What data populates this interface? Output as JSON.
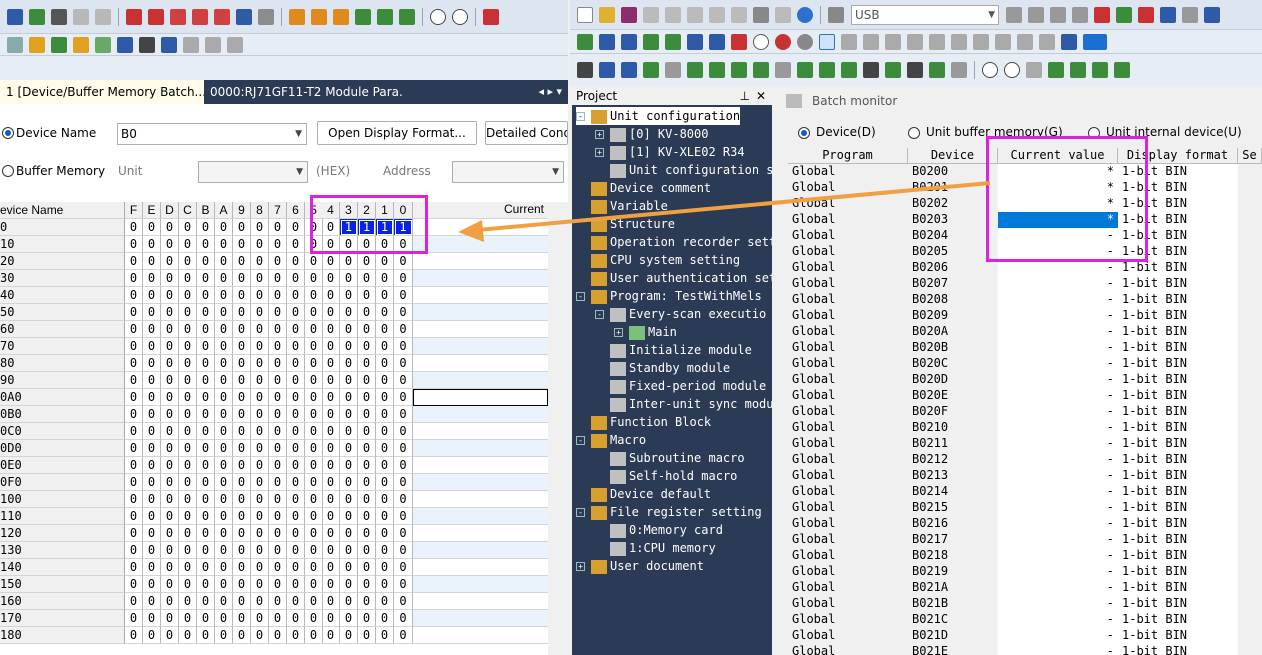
{
  "left": {
    "tabs": [
      {
        "label": "1 [Device/Buffer Memory Batch...",
        "active": true
      },
      {
        "label": "0000:RJ71GF11-T2 Module Para...",
        "active": false
      }
    ],
    "device_name_label": "Device Name",
    "device_name_value": "B0",
    "open_display_format": "Open Display Format...",
    "detailed_conditions": "Detailed Condi",
    "buffer_memory_label": "Buffer Memory",
    "unit_label": "Unit",
    "hex_label": "(HEX)",
    "address_label": "Address",
    "grid_header": {
      "name": "evice Name",
      "bits": [
        "F",
        "E",
        "D",
        "C",
        "B",
        "A",
        "9",
        "8",
        "7",
        "6",
        "5",
        "4",
        "3",
        "2",
        "1",
        "0"
      ],
      "current": "Current"
    },
    "grid_rows": [
      {
        "name": "0",
        "bits": [
          "0",
          "0",
          "0",
          "0",
          "0",
          "0",
          "0",
          "0",
          "0",
          "0",
          "0",
          "0",
          "1",
          "1",
          "1",
          "1"
        ]
      },
      {
        "name": "10",
        "bits": [
          "0",
          "0",
          "0",
          "0",
          "0",
          "0",
          "0",
          "0",
          "0",
          "0",
          "0",
          "0",
          "0",
          "0",
          "0",
          "0"
        ]
      },
      {
        "name": "20",
        "bits": [
          "0",
          "0",
          "0",
          "0",
          "0",
          "0",
          "0",
          "0",
          "0",
          "0",
          "0",
          "0",
          "0",
          "0",
          "0",
          "0"
        ]
      },
      {
        "name": "30",
        "bits": [
          "0",
          "0",
          "0",
          "0",
          "0",
          "0",
          "0",
          "0",
          "0",
          "0",
          "0",
          "0",
          "0",
          "0",
          "0",
          "0"
        ]
      },
      {
        "name": "40",
        "bits": [
          "0",
          "0",
          "0",
          "0",
          "0",
          "0",
          "0",
          "0",
          "0",
          "0",
          "0",
          "0",
          "0",
          "0",
          "0",
          "0"
        ]
      },
      {
        "name": "50",
        "bits": [
          "0",
          "0",
          "0",
          "0",
          "0",
          "0",
          "0",
          "0",
          "0",
          "0",
          "0",
          "0",
          "0",
          "0",
          "0",
          "0"
        ]
      },
      {
        "name": "60",
        "bits": [
          "0",
          "0",
          "0",
          "0",
          "0",
          "0",
          "0",
          "0",
          "0",
          "0",
          "0",
          "0",
          "0",
          "0",
          "0",
          "0"
        ]
      },
      {
        "name": "70",
        "bits": [
          "0",
          "0",
          "0",
          "0",
          "0",
          "0",
          "0",
          "0",
          "0",
          "0",
          "0",
          "0",
          "0",
          "0",
          "0",
          "0"
        ]
      },
      {
        "name": "80",
        "bits": [
          "0",
          "0",
          "0",
          "0",
          "0",
          "0",
          "0",
          "0",
          "0",
          "0",
          "0",
          "0",
          "0",
          "0",
          "0",
          "0"
        ]
      },
      {
        "name": "90",
        "bits": [
          "0",
          "0",
          "0",
          "0",
          "0",
          "0",
          "0",
          "0",
          "0",
          "0",
          "0",
          "0",
          "0",
          "0",
          "0",
          "0"
        ]
      },
      {
        "name": "0A0",
        "bits": [
          "0",
          "0",
          "0",
          "0",
          "0",
          "0",
          "0",
          "0",
          "0",
          "0",
          "0",
          "0",
          "0",
          "0",
          "0",
          "0"
        ]
      },
      {
        "name": "0B0",
        "bits": [
          "0",
          "0",
          "0",
          "0",
          "0",
          "0",
          "0",
          "0",
          "0",
          "0",
          "0",
          "0",
          "0",
          "0",
          "0",
          "0"
        ]
      },
      {
        "name": "0C0",
        "bits": [
          "0",
          "0",
          "0",
          "0",
          "0",
          "0",
          "0",
          "0",
          "0",
          "0",
          "0",
          "0",
          "0",
          "0",
          "0",
          "0"
        ]
      },
      {
        "name": "0D0",
        "bits": [
          "0",
          "0",
          "0",
          "0",
          "0",
          "0",
          "0",
          "0",
          "0",
          "0",
          "0",
          "0",
          "0",
          "0",
          "0",
          "0"
        ]
      },
      {
        "name": "0E0",
        "bits": [
          "0",
          "0",
          "0",
          "0",
          "0",
          "0",
          "0",
          "0",
          "0",
          "0",
          "0",
          "0",
          "0",
          "0",
          "0",
          "0"
        ]
      },
      {
        "name": "0F0",
        "bits": [
          "0",
          "0",
          "0",
          "0",
          "0",
          "0",
          "0",
          "0",
          "0",
          "0",
          "0",
          "0",
          "0",
          "0",
          "0",
          "0"
        ]
      },
      {
        "name": "100",
        "bits": [
          "0",
          "0",
          "0",
          "0",
          "0",
          "0",
          "0",
          "0",
          "0",
          "0",
          "0",
          "0",
          "0",
          "0",
          "0",
          "0"
        ]
      },
      {
        "name": "110",
        "bits": [
          "0",
          "0",
          "0",
          "0",
          "0",
          "0",
          "0",
          "0",
          "0",
          "0",
          "0",
          "0",
          "0",
          "0",
          "0",
          "0"
        ]
      },
      {
        "name": "120",
        "bits": [
          "0",
          "0",
          "0",
          "0",
          "0",
          "0",
          "0",
          "0",
          "0",
          "0",
          "0",
          "0",
          "0",
          "0",
          "0",
          "0"
        ]
      },
      {
        "name": "130",
        "bits": [
          "0",
          "0",
          "0",
          "0",
          "0",
          "0",
          "0",
          "0",
          "0",
          "0",
          "0",
          "0",
          "0",
          "0",
          "0",
          "0"
        ]
      },
      {
        "name": "140",
        "bits": [
          "0",
          "0",
          "0",
          "0",
          "0",
          "0",
          "0",
          "0",
          "0",
          "0",
          "0",
          "0",
          "0",
          "0",
          "0",
          "0"
        ]
      },
      {
        "name": "150",
        "bits": [
          "0",
          "0",
          "0",
          "0",
          "0",
          "0",
          "0",
          "0",
          "0",
          "0",
          "0",
          "0",
          "0",
          "0",
          "0",
          "0"
        ]
      },
      {
        "name": "160",
        "bits": [
          "0",
          "0",
          "0",
          "0",
          "0",
          "0",
          "0",
          "0",
          "0",
          "0",
          "0",
          "0",
          "0",
          "0",
          "0",
          "0"
        ]
      },
      {
        "name": "170",
        "bits": [
          "0",
          "0",
          "0",
          "0",
          "0",
          "0",
          "0",
          "0",
          "0",
          "0",
          "0",
          "0",
          "0",
          "0",
          "0",
          "0"
        ]
      },
      {
        "name": "180",
        "bits": [
          "0",
          "0",
          "0",
          "0",
          "0",
          "0",
          "0",
          "0",
          "0",
          "0",
          "0",
          "0",
          "0",
          "0",
          "0",
          "0"
        ]
      }
    ]
  },
  "right": {
    "toolbar_combo": "USB",
    "project_title": "Project",
    "project_items": [
      {
        "text": "Unit configuration",
        "level": 0,
        "exp": "-",
        "selected": true
      },
      {
        "text": "[0]  KV-8000",
        "level": 1,
        "exp": "+"
      },
      {
        "text": "[1]  KV-XLE02   R34",
        "level": 1,
        "exp": "+"
      },
      {
        "text": "Unit configuration s",
        "level": 1,
        "exp": ""
      },
      {
        "text": "Device comment",
        "level": 0,
        "exp": ""
      },
      {
        "text": "Variable",
        "level": 0,
        "exp": ""
      },
      {
        "text": "Structure",
        "level": 0,
        "exp": ""
      },
      {
        "text": "Operation recorder sett",
        "level": 0,
        "exp": ""
      },
      {
        "text": "CPU system setting",
        "level": 0,
        "exp": ""
      },
      {
        "text": "User authentication set",
        "level": 0,
        "exp": ""
      },
      {
        "text": "Program: TestWithMels",
        "level": 0,
        "exp": "-"
      },
      {
        "text": "Every-scan executio",
        "level": 1,
        "exp": "-"
      },
      {
        "text": "Main",
        "level": 2,
        "exp": "+"
      },
      {
        "text": "Initialize module",
        "level": 1,
        "exp": ""
      },
      {
        "text": "Standby module",
        "level": 1,
        "exp": ""
      },
      {
        "text": "Fixed-period module",
        "level": 1,
        "exp": ""
      },
      {
        "text": "Inter-unit sync modu",
        "level": 1,
        "exp": ""
      },
      {
        "text": "Function Block",
        "level": 0,
        "exp": ""
      },
      {
        "text": "Macro",
        "level": 0,
        "exp": "-"
      },
      {
        "text": "Subroutine macro",
        "level": 1,
        "exp": ""
      },
      {
        "text": "Self-hold macro",
        "level": 1,
        "exp": ""
      },
      {
        "text": "Device default",
        "level": 0,
        "exp": ""
      },
      {
        "text": "File register setting",
        "level": 0,
        "exp": "-"
      },
      {
        "text": "0:Memory card",
        "level": 1,
        "exp": ""
      },
      {
        "text": "1:CPU memory",
        "level": 1,
        "exp": ""
      },
      {
        "text": "User document",
        "level": 0,
        "exp": "+"
      }
    ],
    "batch_title": "Batch monitor",
    "radio_device": "Device(D)",
    "radio_buffer": "Unit buffer memory(G)",
    "radio_internal": "Unit internal device(U)",
    "table_headers": [
      "Program",
      "Device",
      "Current value",
      "Display format",
      "Se"
    ],
    "table_rows": [
      [
        "Global",
        "B0200",
        "*",
        "1-bit BIN"
      ],
      [
        "Global",
        "B0201",
        "*",
        "1-bit BIN"
      ],
      [
        "Global",
        "B0202",
        "*",
        "1-bit BIN"
      ],
      [
        "Global",
        "B0203",
        "*",
        "1-bit BIN"
      ],
      [
        "Global",
        "B0204",
        "-",
        "1-bit BIN"
      ],
      [
        "Global",
        "B0205",
        "-",
        "1-bit BIN"
      ],
      [
        "Global",
        "B0206",
        "-",
        "1-bit BIN"
      ],
      [
        "Global",
        "B0207",
        "-",
        "1-bit BIN"
      ],
      [
        "Global",
        "B0208",
        "-",
        "1-bit BIN"
      ],
      [
        "Global",
        "B0209",
        "-",
        "1-bit BIN"
      ],
      [
        "Global",
        "B020A",
        "-",
        "1-bit BIN"
      ],
      [
        "Global",
        "B020B",
        "-",
        "1-bit BIN"
      ],
      [
        "Global",
        "B020C",
        "-",
        "1-bit BIN"
      ],
      [
        "Global",
        "B020D",
        "-",
        "1-bit BIN"
      ],
      [
        "Global",
        "B020E",
        "-",
        "1-bit BIN"
      ],
      [
        "Global",
        "B020F",
        "-",
        "1-bit BIN"
      ],
      [
        "Global",
        "B0210",
        "-",
        "1-bit BIN"
      ],
      [
        "Global",
        "B0211",
        "-",
        "1-bit BIN"
      ],
      [
        "Global",
        "B0212",
        "-",
        "1-bit BIN"
      ],
      [
        "Global",
        "B0213",
        "-",
        "1-bit BIN"
      ],
      [
        "Global",
        "B0214",
        "-",
        "1-bit BIN"
      ],
      [
        "Global",
        "B0215",
        "-",
        "1-bit BIN"
      ],
      [
        "Global",
        "B0216",
        "-",
        "1-bit BIN"
      ],
      [
        "Global",
        "B0217",
        "-",
        "1-bit BIN"
      ],
      [
        "Global",
        "B0218",
        "-",
        "1-bit BIN"
      ],
      [
        "Global",
        "B0219",
        "-",
        "1-bit BIN"
      ],
      [
        "Global",
        "B021A",
        "-",
        "1-bit BIN"
      ],
      [
        "Global",
        "B021B",
        "-",
        "1-bit BIN"
      ],
      [
        "Global",
        "B021C",
        "-",
        "1-bit BIN"
      ],
      [
        "Global",
        "B021D",
        "-",
        "1-bit BIN"
      ],
      [
        "Global",
        "B021E",
        "-",
        "1-bit BIN"
      ]
    ]
  }
}
